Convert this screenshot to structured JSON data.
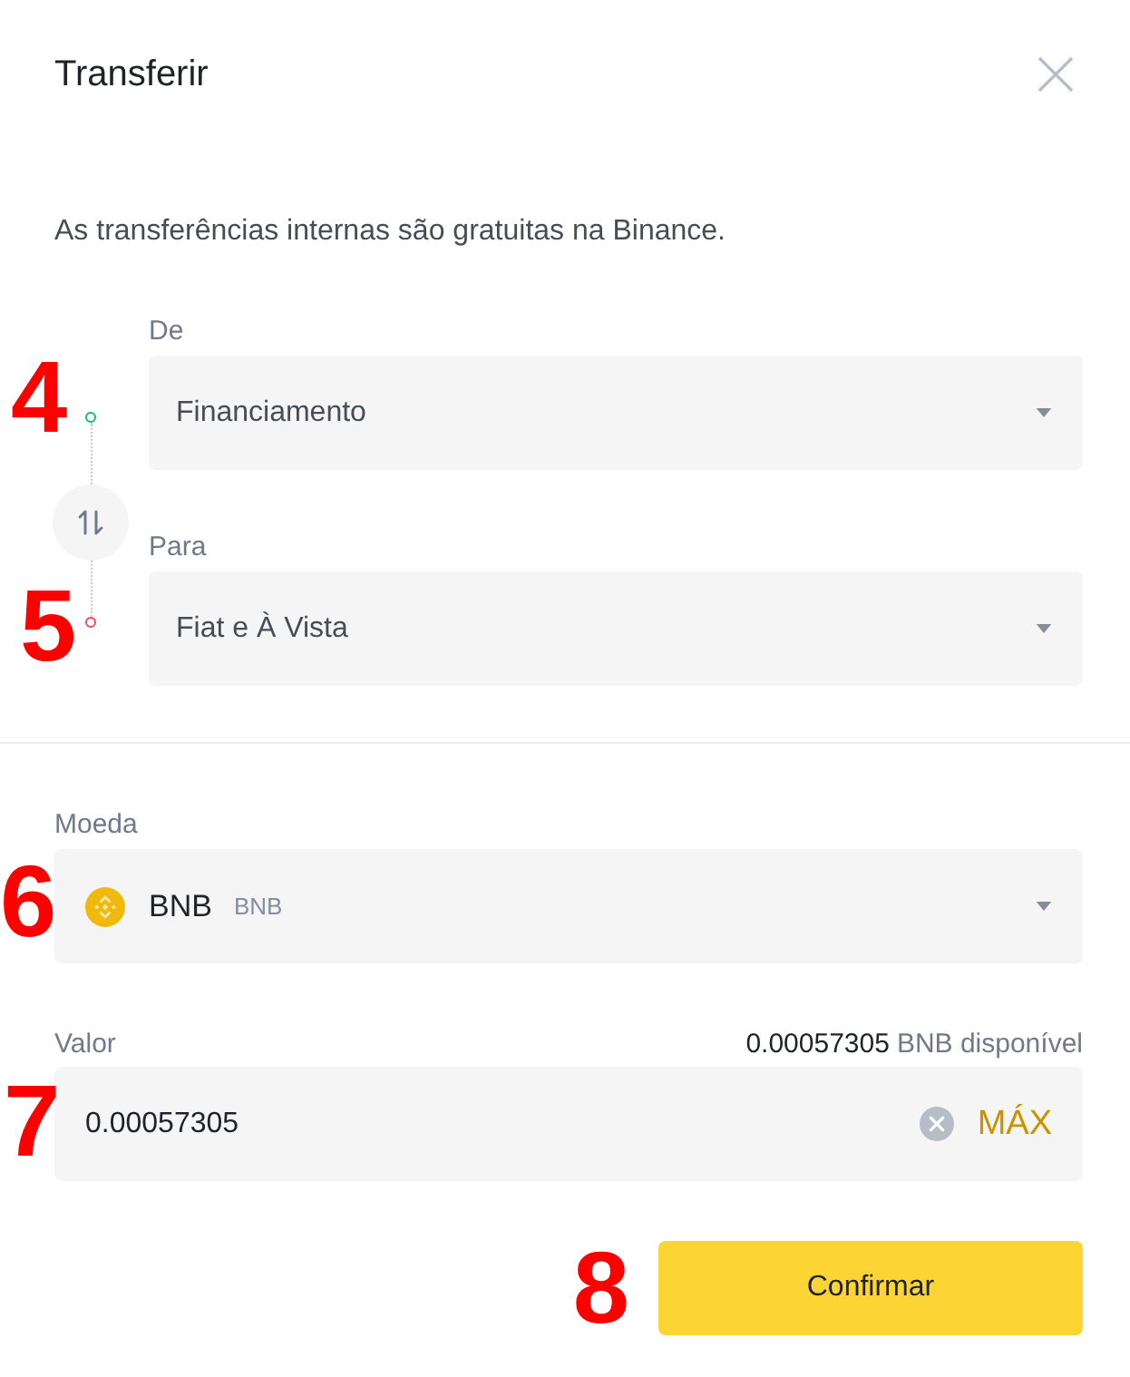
{
  "dialog": {
    "title": "Transferir"
  },
  "notice": "As transferências internas são gratuitas na Binance.",
  "accounts": [
    {
      "label": "De",
      "value": "Financiamento",
      "color": "#02c076",
      "marker": "4"
    },
    {
      "label": "Para",
      "value": "Fiat e À Vista",
      "color": "#f6465d",
      "marker": "5"
    }
  ],
  "coin": {
    "label": "Moeda",
    "symbol": "BNB",
    "name": "BNB",
    "marker": "6"
  },
  "amount": {
    "label": "Valor",
    "available_amount": "0.00057305",
    "available_text": "BNB disponível",
    "value": "0.00057305",
    "max_label": "MÁX",
    "marker": "7"
  },
  "confirm": {
    "label": "Confirmar",
    "marker": "8"
  }
}
